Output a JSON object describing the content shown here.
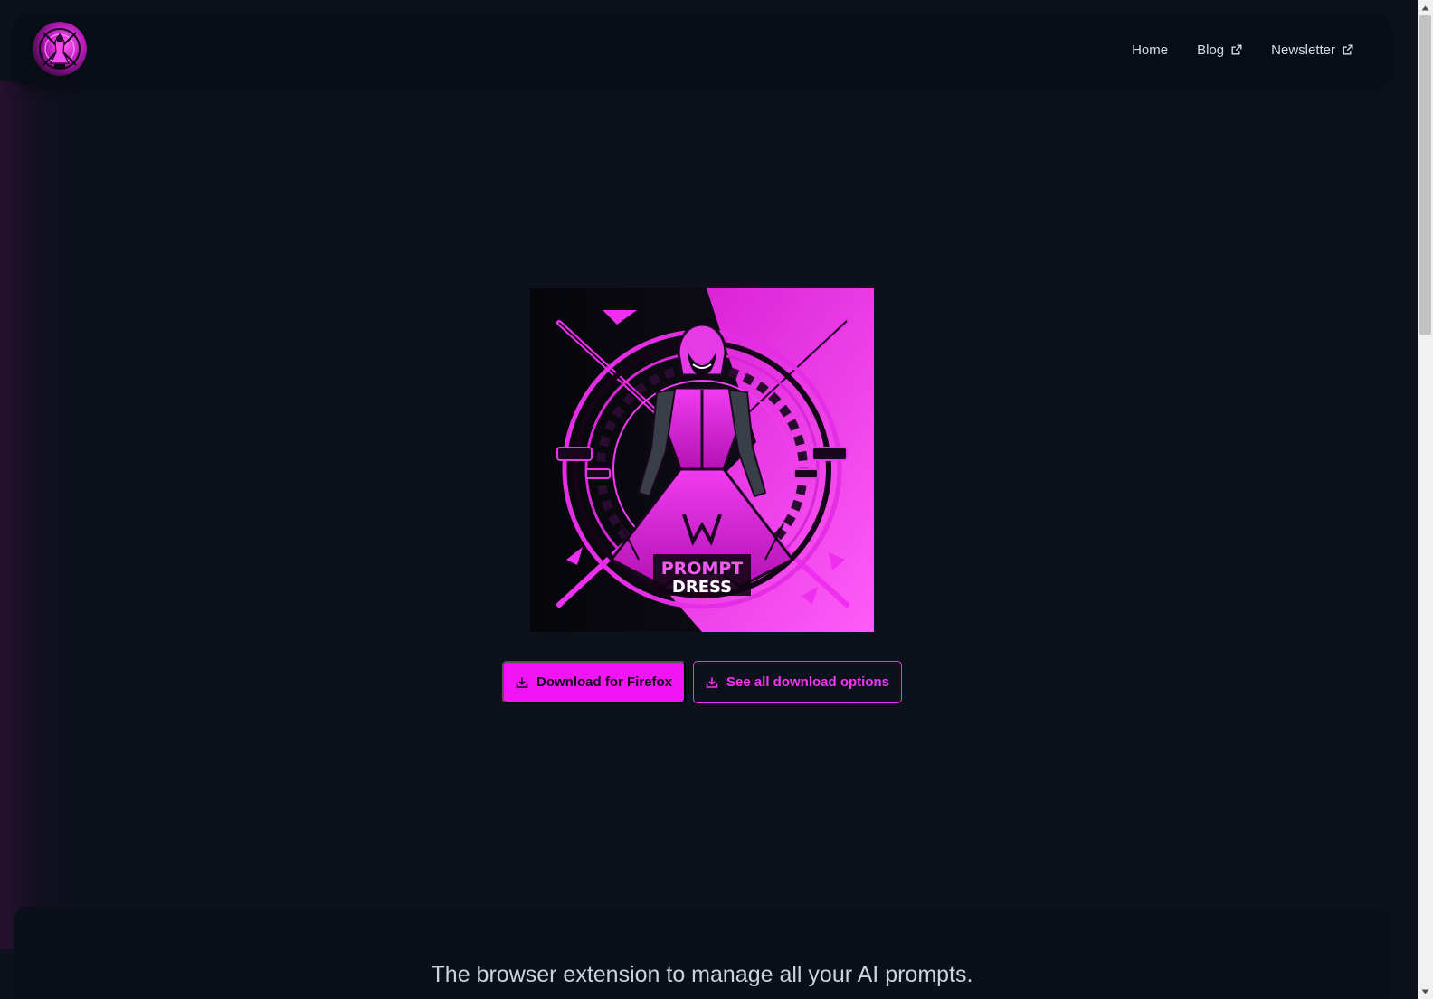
{
  "nav": {
    "links": [
      {
        "label": "Home"
      },
      {
        "label": "Blog"
      },
      {
        "label": "Newsletter"
      }
    ]
  },
  "hero": {
    "logo_line1": "PROMPT",
    "logo_line2": "DRESS",
    "download_firefox_label": "Download for Firefox",
    "see_all_label": "See all download options"
  },
  "tagline": "The browser extension to manage all your AI prompts.",
  "colors": {
    "accent": "#f114f5",
    "background": "#0c111c",
    "navbar": "#080c14"
  },
  "icons": {
    "external": "external-link-icon",
    "download": "download-icon"
  }
}
